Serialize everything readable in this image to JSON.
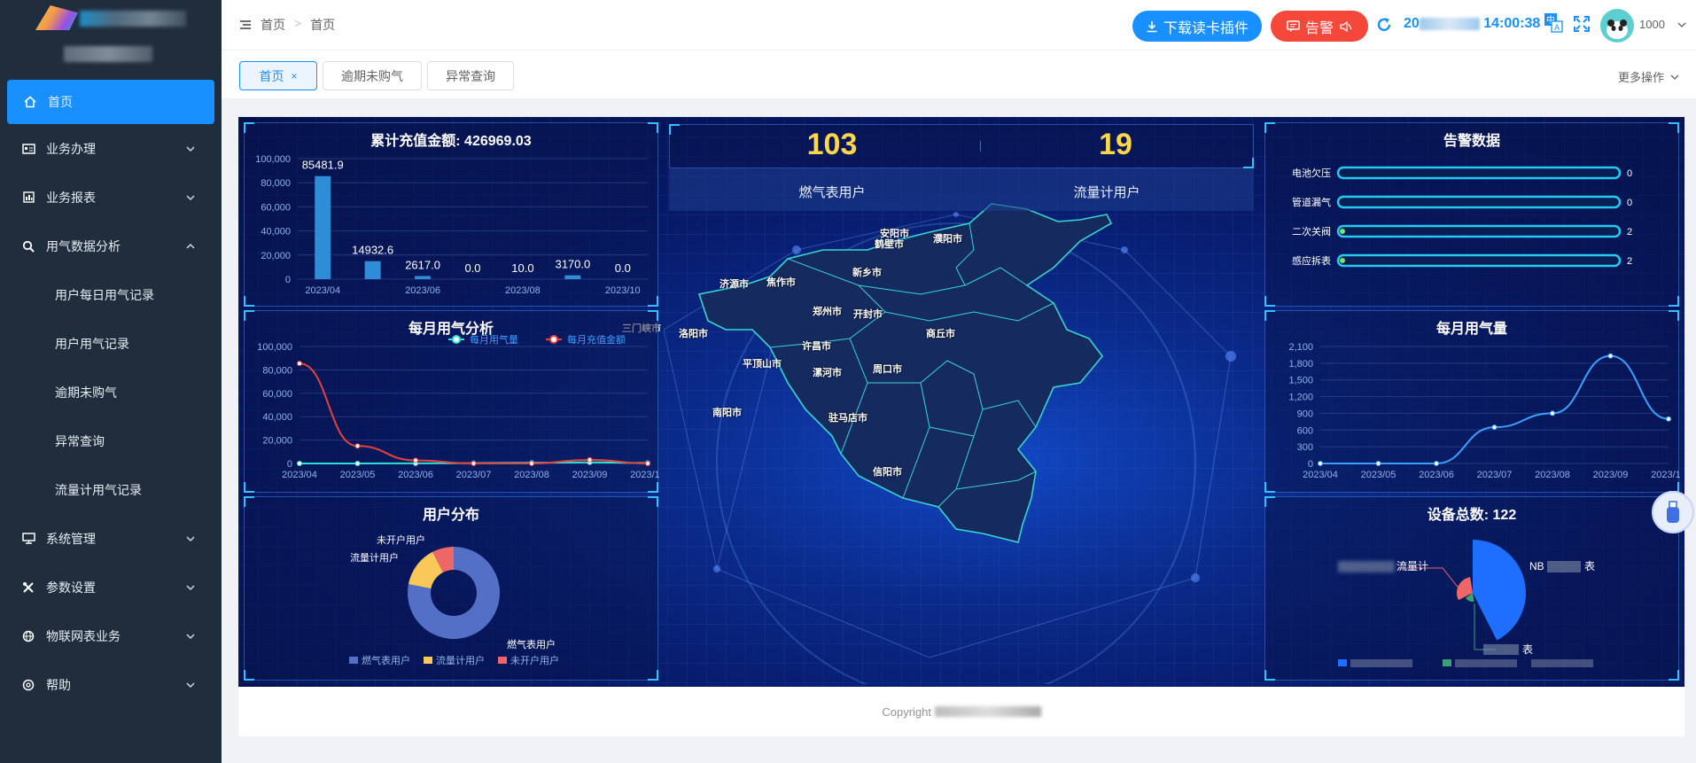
{
  "sidebar": {
    "items": [
      {
        "label": "首页",
        "icon": "home-icon",
        "active": true
      },
      {
        "label": "业务办理",
        "icon": "id-card-icon"
      },
      {
        "label": "业务报表",
        "icon": "bar-chart-icon"
      },
      {
        "label": "用气数据分析",
        "icon": "search-icon",
        "expanded": true
      },
      {
        "label": "系统管理",
        "icon": "monitor-icon"
      },
      {
        "label": "参数设置",
        "icon": "tools-icon"
      },
      {
        "label": "物联网表业务",
        "icon": "globe-icon"
      },
      {
        "label": "帮助",
        "icon": "help-icon"
      }
    ],
    "subitems": [
      "用户每日用气记录",
      "用户用气记录",
      "逾期未购气",
      "异常查询",
      "流量计用气记录"
    ]
  },
  "header": {
    "breadcrumb": [
      "首页",
      "首页"
    ],
    "download_button": "下载读卡插件",
    "alarm_button": "告警",
    "datetime_prefix": "20",
    "datetime_suffix": "14:00:38",
    "username": "1000"
  },
  "tags": {
    "items": [
      "首页",
      "逾期未购气",
      "异常查询"
    ],
    "close": "×",
    "more_ops": "更多操作"
  },
  "dashboard": {
    "recharge_title": "累计充值金额: 426969.03",
    "monthly_usage_title": "每月用气分析",
    "user_dist_title": "用户分布",
    "gas_users_count": "103",
    "flow_users_count": "19",
    "gas_users_label": "燃气表用户",
    "flow_users_label": "流量计用户",
    "alarm_title": "告警数据",
    "monthly_volume_title": "每月用气量",
    "device_total_title": "设备总数: 122",
    "cities": [
      "安阳市",
      "鹤壁市",
      "濮阳市",
      "新乡市",
      "济源市",
      "焦作市",
      "郑州市",
      "开封市",
      "三门峡市",
      "洛阳市",
      "商丘市",
      "许昌市",
      "平顶山市",
      "漯河市",
      "周口市",
      "南阳市",
      "驻马店市",
      "信阳市"
    ],
    "device_labels": [
      "流量计",
      "NB",
      "表",
      "表"
    ]
  },
  "footer": {
    "text": "Copyright"
  },
  "colors": {
    "primary": "#1890ff",
    "alarm": "#f5483b",
    "sidebar": "#1f2d3d",
    "highlight": "#ffd84a"
  },
  "chart_data": [
    {
      "type": "bar",
      "title": "累计充值金额: 426969.03",
      "categories": [
        "2023/04",
        "2023/05",
        "2023/06",
        "2023/07",
        "2023/08",
        "2023/09",
        "2023/10"
      ],
      "x_tick_labels": [
        "2023/04",
        "2023/06",
        "2023/08",
        "2023/10"
      ],
      "values": [
        85481.9,
        14932.6,
        2617.0,
        0.0,
        10.0,
        3170.0,
        0.0
      ],
      "value_labels": [
        "85481.9",
        "14932.6",
        "2617.0",
        "0.0",
        "10.0",
        "3170.0",
        "0.0"
      ],
      "ylim": [
        0,
        100000
      ],
      "yticks": [
        "0",
        "20,000",
        "40,000",
        "60,000",
        "80,000",
        "100,000"
      ]
    },
    {
      "type": "line",
      "title": "每月用气分析",
      "categories": [
        "2023/04",
        "2023/05",
        "2023/06",
        "2023/07",
        "2023/08",
        "2023/09",
        "2023/10"
      ],
      "series": [
        {
          "name": "每月用气量",
          "color": "#2de3d8",
          "values": [
            0,
            0,
            100,
            300,
            600,
            900,
            500
          ]
        },
        {
          "name": "每月充值金额",
          "color": "#e8423a",
          "values": [
            85481.9,
            14932.6,
            2617.0,
            0.0,
            10.0,
            3170.0,
            0.0
          ]
        }
      ],
      "ylim": [
        0,
        100000
      ],
      "yticks": [
        "0",
        "20,000",
        "40,000",
        "60,000",
        "80,000",
        "100,000"
      ]
    },
    {
      "type": "pie",
      "title": "用户分布",
      "slices": [
        {
          "name": "燃气表用户",
          "value": 103,
          "color": "#5470c6"
        },
        {
          "name": "流量计用户",
          "value": 19,
          "color": "#fac858"
        },
        {
          "name": "未开户用户",
          "value": 10,
          "color": "#ee6666"
        }
      ]
    },
    {
      "type": "bar",
      "title": "告警数据",
      "orientation": "horizontal",
      "categories": [
        "电池欠压",
        "管道漏气",
        "二次关阀",
        "感应拆表"
      ],
      "values": [
        0,
        0,
        2,
        2
      ],
      "value_labels": [
        "0",
        "0",
        "2",
        "2"
      ]
    },
    {
      "type": "line",
      "title": "每月用气量",
      "categories": [
        "2023/04",
        "2023/05",
        "2023/06",
        "2023/07",
        "2023/08",
        "2023/09",
        "2023/10"
      ],
      "series": [
        {
          "values": [
            0,
            0,
            0,
            650,
            900,
            1930,
            800
          ],
          "color": "#3ba0ff"
        }
      ],
      "ylim": [
        0,
        2100
      ],
      "yticks": [
        "0",
        "300",
        "600",
        "900",
        "1,200",
        "1,500",
        "1,800",
        "2,100"
      ]
    },
    {
      "type": "pie",
      "title": "设备总数: 122",
      "slices": [
        {
          "name": "NB",
          "value": 100,
          "color": "#1e6fff"
        },
        {
          "name": "流量计",
          "value": 19,
          "color": "#ee6666"
        },
        {
          "name": "表",
          "value": 3,
          "color": "#3ba272"
        }
      ]
    }
  ]
}
